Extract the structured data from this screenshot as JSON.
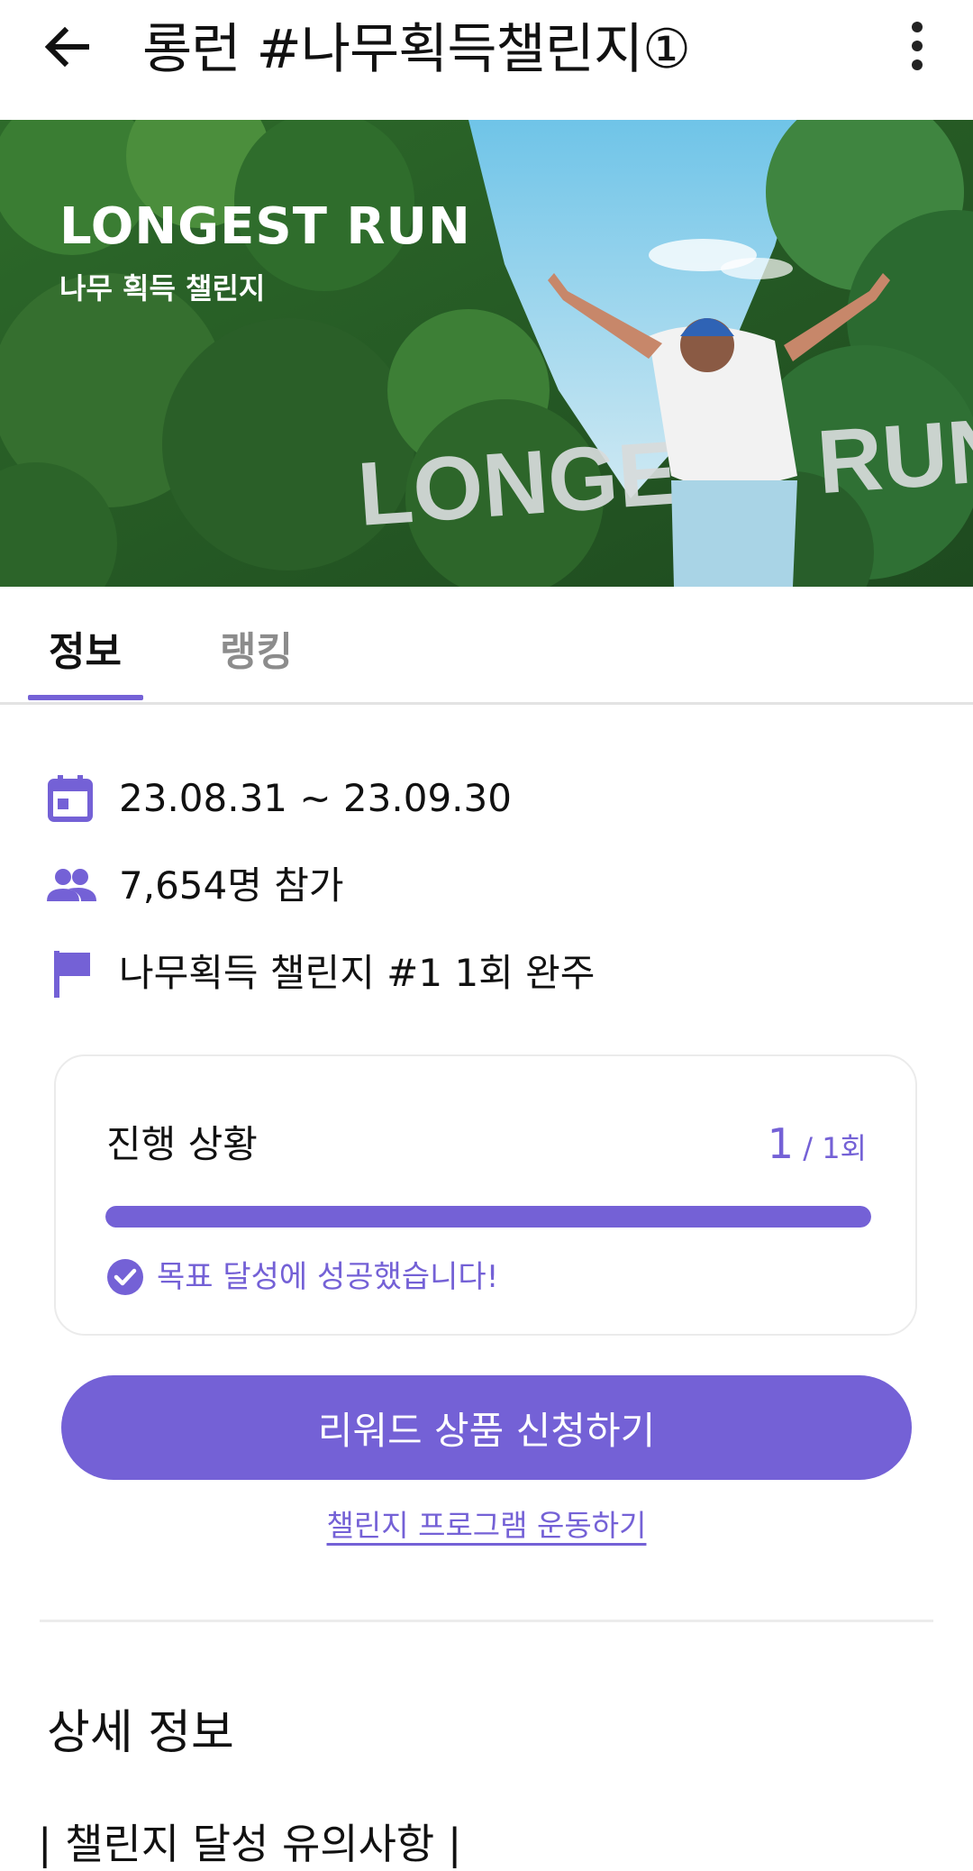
{
  "header": {
    "title": "롱런 #나무획득챌린지①",
    "back_icon": "arrow-left-icon",
    "more_icon": "more-vert-icon"
  },
  "banner": {
    "title": "LONGEST RUN",
    "subtitle": "나무 획득 챌린지",
    "art_text": "LONGEST RUN"
  },
  "tabs": [
    {
      "label": "정보",
      "selected": true
    },
    {
      "label": "랭킹",
      "selected": false
    }
  ],
  "info": {
    "period": "23.08.31 ~ 23.09.30",
    "participants": "7,654명 참가",
    "goal": "나무획득 챌린지 #1 1회 완주"
  },
  "progress": {
    "label": "진행 상황",
    "current": "1",
    "total_text": " / 1회",
    "fraction": 1.0,
    "success_message": "목표 달성에 성공했습니다!"
  },
  "reward_button": "리워드 상품 신청하기",
  "program_link": "챌린지 프로그램 운동하기",
  "details": {
    "title": "상세 정보",
    "notice_heading": "| 챌린지 달성 유의사항 |"
  },
  "colors": {
    "accent": "#7461d6",
    "text": "#111111",
    "muted": "#8c8c8c",
    "divider": "#ececec"
  }
}
